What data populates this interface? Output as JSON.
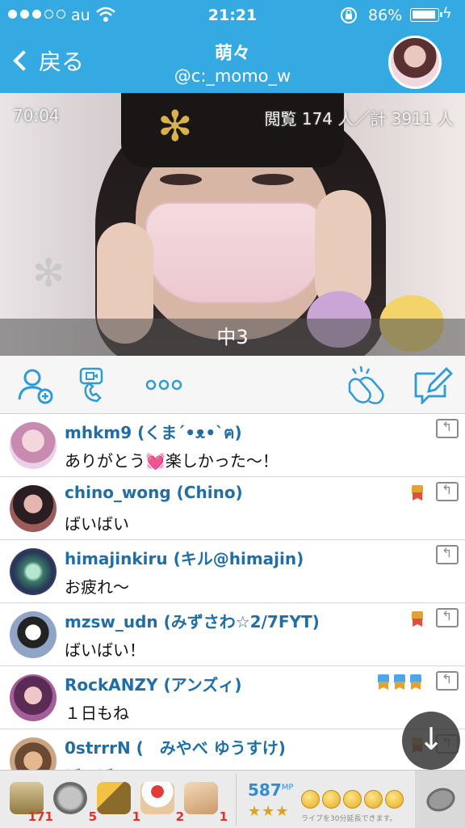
{
  "status_bar": {
    "carrier": "au",
    "time": "21:21",
    "battery_pct": "86%"
  },
  "nav": {
    "back_label": "戻る",
    "title": "萌々",
    "handle": "@c:_momo_w"
  },
  "video": {
    "elapsed": "70:04",
    "viewers": "閲覧 174 人／計 3911 人",
    "caption": "中3"
  },
  "actions": [
    {
      "name": "add-user-icon"
    },
    {
      "name": "call-icon"
    },
    {
      "name": "more-icon"
    },
    {
      "name": "clap-icon"
    },
    {
      "name": "compose-icon"
    }
  ],
  "comments": [
    {
      "user": "mhkm9 (くま´•ᴥ•`ฅ)",
      "message": "ありがとう💓楽しかった〜！",
      "badges": []
    },
    {
      "user": "chino_wong (Chino)",
      "message": "ばいばい",
      "badges": [
        "gold"
      ]
    },
    {
      "user": "himajinkiru (キル@himajin)",
      "message": "お疲れ〜",
      "badges": []
    },
    {
      "user": "mzsw_udn (みずさわ☆2/7FYT)",
      "message": "ばいばい！",
      "badges": [
        "gold"
      ]
    },
    {
      "user": "RockANZY (アンズィ)",
      "message": "１日もね",
      "badges": [
        "blue",
        "blue",
        "blue"
      ]
    },
    {
      "user": "0strrrN (　みやべ ゆうすけ)",
      "message": "ばいばい",
      "badges": [
        "gold"
      ]
    }
  ],
  "gifts": [
    {
      "name": "tea-gift-icon",
      "count": "171"
    },
    {
      "name": "coin-gift-icon",
      "count": "5"
    },
    {
      "name": "cracker-gift-icon",
      "count": "1"
    },
    {
      "name": "cake-gift-icon",
      "count": "2"
    },
    {
      "name": "clap-gift-icon",
      "count": "1"
    }
  ],
  "mp": {
    "value": "587",
    "unit": "MP",
    "stars": "★★★",
    "extend_note": "ライブを30分延長できます。"
  },
  "colors": {
    "nav_bg": "#34a9e2",
    "username": "#1e6fa8",
    "gift_count": "#e0312b",
    "mp": "#2e8fd0"
  }
}
